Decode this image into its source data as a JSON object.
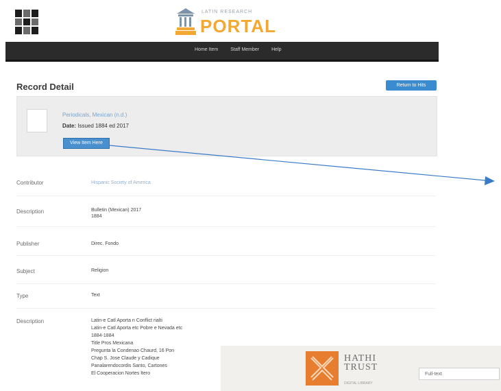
{
  "header": {
    "left_logo_icon": "grid-logo-icon",
    "portal_subtitle": "LATIN RESEARCH",
    "portal_title": "PORTAL",
    "portal_icon": "building-icon",
    "brand_orange": "#f2a833",
    "nav": [
      "Home Item",
      "Staff Member",
      "Help"
    ]
  },
  "page": {
    "title": "Record Detail",
    "return_button": "Return to Hits"
  },
  "record": {
    "title": "Periodicals, Mexican (n.d.)",
    "date_label": "Date:",
    "date_value": "Issued 1884 ed 2017",
    "view_button": "View Item Here",
    "thumbnail_icon": "document-thumbnail-icon"
  },
  "fields": [
    {
      "label": "Contributor",
      "values": [
        "Hispanic Society of America"
      ],
      "link": true
    },
    {
      "label": "Description",
      "values": [
        "Bulletin (Mexican) 2017",
        "1884"
      ],
      "link": false
    },
    {
      "label": "Publisher",
      "values": [
        "Direc. Fondo"
      ],
      "link": false
    },
    {
      "label": "Subject",
      "values": [
        "Religion"
      ],
      "link": false
    },
    {
      "label": "Type",
      "values": [
        "Text"
      ],
      "link": false
    },
    {
      "label": "Description",
      "values": [
        "Latin-e Catl Aporta n Conflict rialti",
        "Latin-e Catl Aporta etc Pobre e Nevada etc",
        "1884-1884",
        "Title Pros Mexicana",
        "Pregunta la Condenao Chaurd, 16 Pon",
        "Chap S. Jose Claude y Cadique",
        "Panalarendocordis Santo, Cartones",
        "El Cooperacion Nortes ltero"
      ],
      "link": false
    }
  ],
  "hathitrust": {
    "logo_text_line1": "HATHI",
    "logo_text_line2": "TRUST",
    "logo_sub": "DIGITAL LIBRARY",
    "logo_color": "#e77d2f",
    "search_placeholder": "Full-text"
  },
  "annotation": {
    "arrow_color": "#3a7bc8"
  }
}
